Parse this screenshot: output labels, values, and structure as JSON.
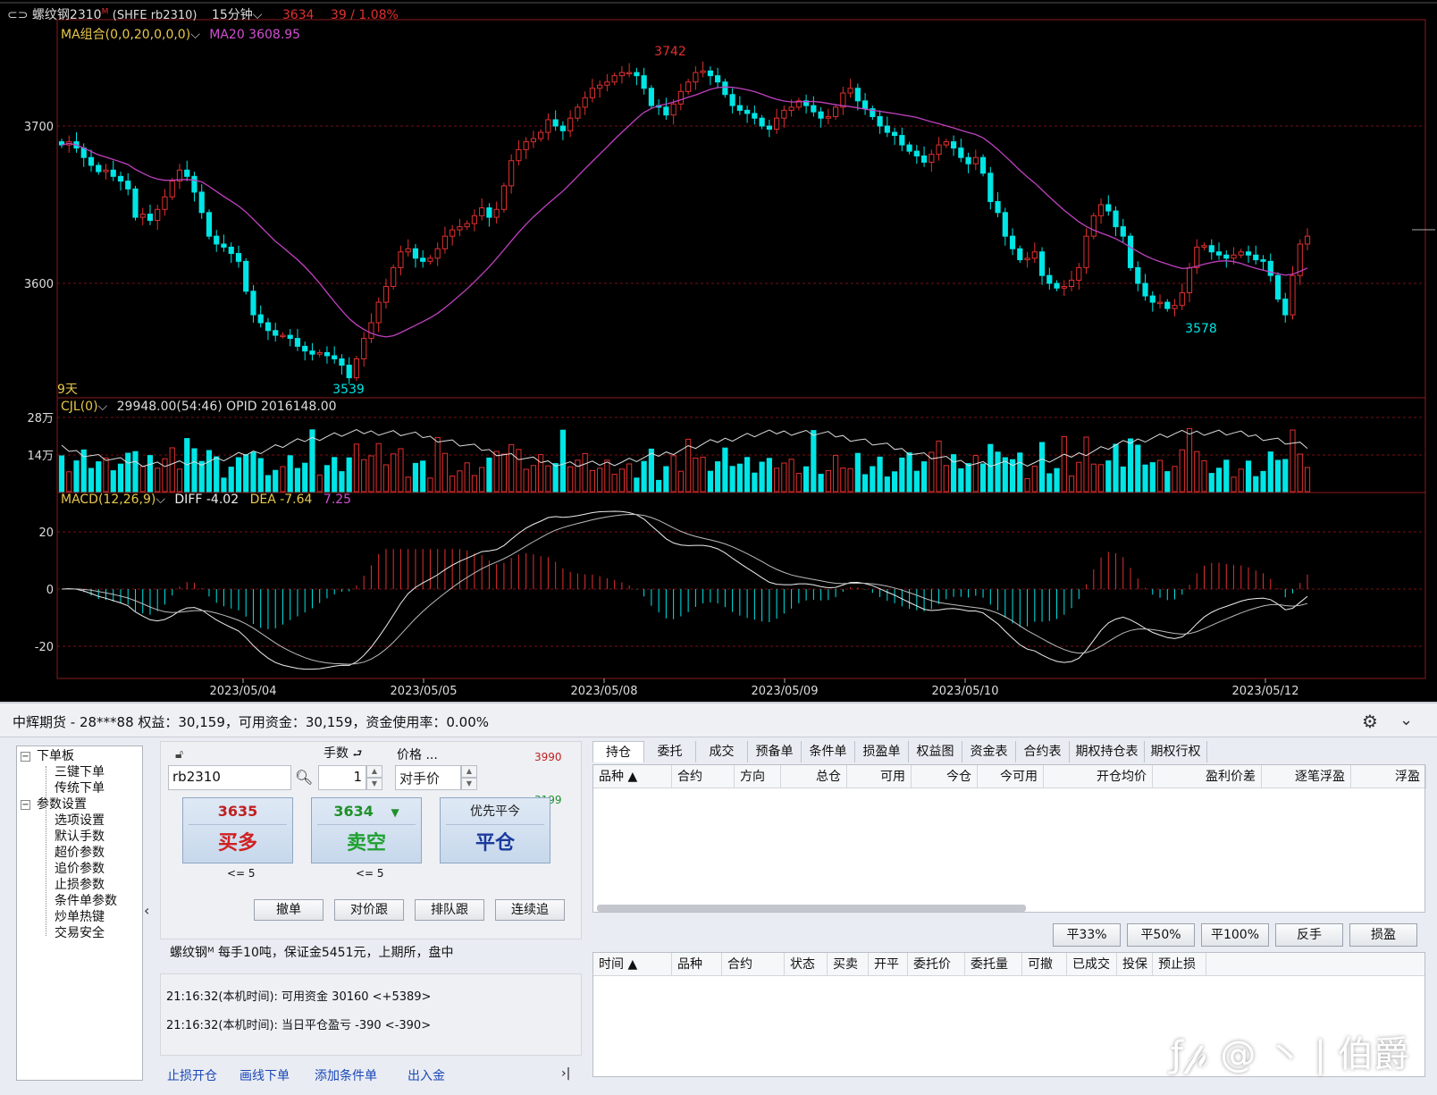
{
  "chart": {
    "header": {
      "symbol": "螺纹钢2310",
      "sup": "M",
      "exchange_code": "(SHFE rb2310)",
      "period": "15分钟",
      "price": "3634",
      "change": "39 / 1.08%"
    },
    "ma_label": "MA组合(0,0,20,0,0,0)",
    "ma_value": "MA20 3608.95",
    "price_ticks": [
      "3700",
      "3600"
    ],
    "price_annotations": {
      "high": "3742",
      "low": "3539",
      "right_low": "3578"
    },
    "days_label": "9天",
    "volume_label": "CJL(0)",
    "volume_value": "29948.00(54:46)  OPID 2016148.00",
    "volume_ticks": [
      "28万",
      "14万"
    ],
    "macd_label": "MACD(12,26,9)",
    "macd_diff": "DIFF -4.02",
    "macd_dea": "DEA -7.64",
    "macd_val": "7.25",
    "macd_ticks": [
      "20",
      "0",
      "-20"
    ],
    "dates": [
      "2023/05/04",
      "2023/05/05",
      "2023/05/08",
      "2023/05/09",
      "2023/05/10",
      "2023/05/12"
    ],
    "colors": {
      "up": "#e0302f",
      "down": "#00e5e5",
      "ma": "#c040c0",
      "grid": "#7a1010"
    }
  },
  "chart_data": {
    "type": "candlestick",
    "title": "螺纹钢2310 15分钟",
    "y_ticks": [
      3700,
      3600
    ],
    "ylim": [
      3525,
      3760
    ],
    "high_label": 3742,
    "low_label": 3539,
    "right_low_label": 3578,
    "close": [
      3688,
      3690,
      3686,
      3680,
      3675,
      3671,
      3672,
      3668,
      3665,
      3660,
      3642,
      3644,
      3640,
      3647,
      3655,
      3665,
      3672,
      3668,
      3658,
      3645,
      3630,
      3625,
      3623,
      3619,
      3614,
      3595,
      3580,
      3575,
      3570,
      3567,
      3567,
      3565,
      3560,
      3557,
      3555,
      3556,
      3554,
      3552,
      3548,
      3540,
      3552,
      3565,
      3575,
      3588,
      3598,
      3610,
      3620,
      3622,
      3616,
      3614,
      3616,
      3622,
      3630,
      3634,
      3636,
      3638,
      3643,
      3648,
      3642,
      3647,
      3662,
      3678,
      3685,
      3690,
      3692,
      3696,
      3704,
      3700,
      3697,
      3705,
      3712,
      3718,
      3724,
      3726,
      3728,
      3732,
      3734,
      3734,
      3732,
      3724,
      3713,
      3712,
      3707,
      3714,
      3722,
      3728,
      3734,
      3735,
      3732,
      3728,
      3720,
      3713,
      3710,
      3708,
      3705,
      3700,
      3698,
      3705,
      3710,
      3712,
      3716,
      3713,
      3709,
      3705,
      3706,
      3712,
      3721,
      3724,
      3716,
      3711,
      3706,
      3700,
      3696,
      3694,
      3688,
      3684,
      3681,
      3677,
      3682,
      3688,
      3690,
      3686,
      3680,
      3676,
      3680,
      3670,
      3652,
      3645,
      3630,
      3622,
      3615,
      3616,
      3620,
      3605,
      3600,
      3597,
      3598,
      3602,
      3610,
      3630,
      3643,
      3650,
      3646,
      3636,
      3630,
      3610,
      3600,
      3592,
      3588,
      3588,
      3584,
      3586,
      3594,
      3610,
      3623,
      3624,
      3620,
      3618,
      3616,
      3618,
      3620,
      3618,
      3615,
      3614,
      3605,
      3590,
      3580,
      3605,
      3625,
      3630
    ],
    "volume_ticks_label": [
      "28万",
      "14万"
    ],
    "macd": {
      "diff": -4.02,
      "dea": -7.64,
      "macd": 7.25,
      "y_ticks": [
        20,
        0,
        -20
      ]
    },
    "x_dates": [
      "2023/05/04",
      "2023/05/05",
      "2023/05/08",
      "2023/05/09",
      "2023/05/10",
      "2023/05/12"
    ]
  },
  "panel": {
    "title": "中辉期货 - 28***88  权益：30,159，可用资金：30,159，资金使用率：0.00%",
    "tree": [
      "下单板",
      "三键下单",
      "传统下单",
      "参数设置",
      "选项设置",
      "默认手数",
      "超价参数",
      "追价参数",
      "止损参数",
      "条件单参数",
      "炒单热键",
      "交易安全"
    ],
    "lots_label": "手数",
    "price_label": "价格",
    "price_more": "...",
    "symbol_value": "rb2310",
    "lots_value": "1",
    "price_value": "对手价",
    "limit_up": "3990",
    "limit_down": "3199",
    "buy": {
      "price": "3635",
      "label": "买多",
      "limit": "<= 5"
    },
    "sell": {
      "price": "3634",
      "arrow": "▼",
      "label": "卖空",
      "limit": "<= 5"
    },
    "close": {
      "top": "优先平今",
      "label": "平仓"
    },
    "small_buttons": [
      "撤单",
      "对价跟",
      "排队跟",
      "连续追"
    ],
    "info": "螺纹钢ᴹ  每手10吨，保证金5451元，上期所，盘中",
    "logs": [
      "21:16:32(本机时间): 可用资金 30160  <+5389>",
      "21:16:32(本机时间): 当日平仓盈亏 -390  <-390>"
    ],
    "links": [
      "止损开仓",
      "画线下单",
      "添加条件单",
      "出入金"
    ],
    "more": "›|",
    "tabs": [
      "持仓",
      "委托",
      "成交",
      "预备单",
      "条件单",
      "损盈单",
      "权益图",
      "资金表",
      "合约表",
      "期权持仓表",
      "期权行权"
    ],
    "pos_headers": [
      "品种 ▲",
      "合约",
      "方向",
      "总仓",
      "可用",
      "今仓",
      "今可用",
      "开仓均价",
      "盈利价差",
      "逐笔浮盈",
      "浮盈"
    ],
    "actions": [
      "平33%",
      "平50%",
      "平100%",
      "反手",
      "损盈"
    ],
    "order_headers": [
      "时间 ▲",
      "品种",
      "合约",
      "状态",
      "买卖",
      "开平",
      "委托价",
      "委托量",
      "可撤",
      "已成交",
      "投保",
      "预止损"
    ],
    "watermark": "伯爵"
  }
}
